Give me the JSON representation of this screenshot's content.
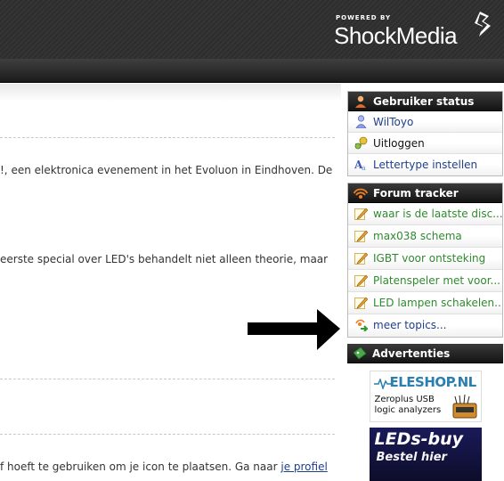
{
  "header": {
    "powered_by": "POWERED BY",
    "brand": "ShockMedia"
  },
  "main": {
    "line1": "!, een elektronica evenement in het Evoluon in Eindhoven. De",
    "line2": "eerste special over LED's behandelt niet alleen theorie, maar",
    "line3_text": "f hoeft te gebruiken om je icon te plaatsen. Ga naar ",
    "line3_link": "je profiel"
  },
  "sidebar": {
    "user_status": {
      "title": "Gebruiker status",
      "items": [
        {
          "label": "WilToyo",
          "icon": "user-icon"
        },
        {
          "label": "Uitloggen",
          "icon": "keys-icon"
        },
        {
          "label": "Lettertype instellen",
          "icon": "font-icon"
        }
      ]
    },
    "forum_tracker": {
      "title": "Forum tracker",
      "items": [
        {
          "label": "waar is de laatste disc...",
          "icon": "pencil-icon"
        },
        {
          "label": "max038 schema",
          "icon": "pencil-icon"
        },
        {
          "label": "IGBT voor ontsteking",
          "icon": "pencil-icon"
        },
        {
          "label": "Platenspeler met voor...",
          "icon": "pencil-icon"
        },
        {
          "label": "LED lampen schakelen...",
          "icon": "pencil-icon"
        },
        {
          "label": "meer topics...",
          "icon": "more-topics-icon"
        }
      ]
    },
    "ads": {
      "title": "Advertenties",
      "ad1_title": "ELESHOP.NL",
      "ad1_sub1": "Zeroplus USB",
      "ad1_sub2": "logic analyzers",
      "ad2_title": "LEDs-buy",
      "ad2_sub": "Bestel hier"
    }
  },
  "colors": {
    "link_blue": "#1e3f8a",
    "tracker_green": "#2f8a2f",
    "header_dark": "#2d2d2d"
  }
}
